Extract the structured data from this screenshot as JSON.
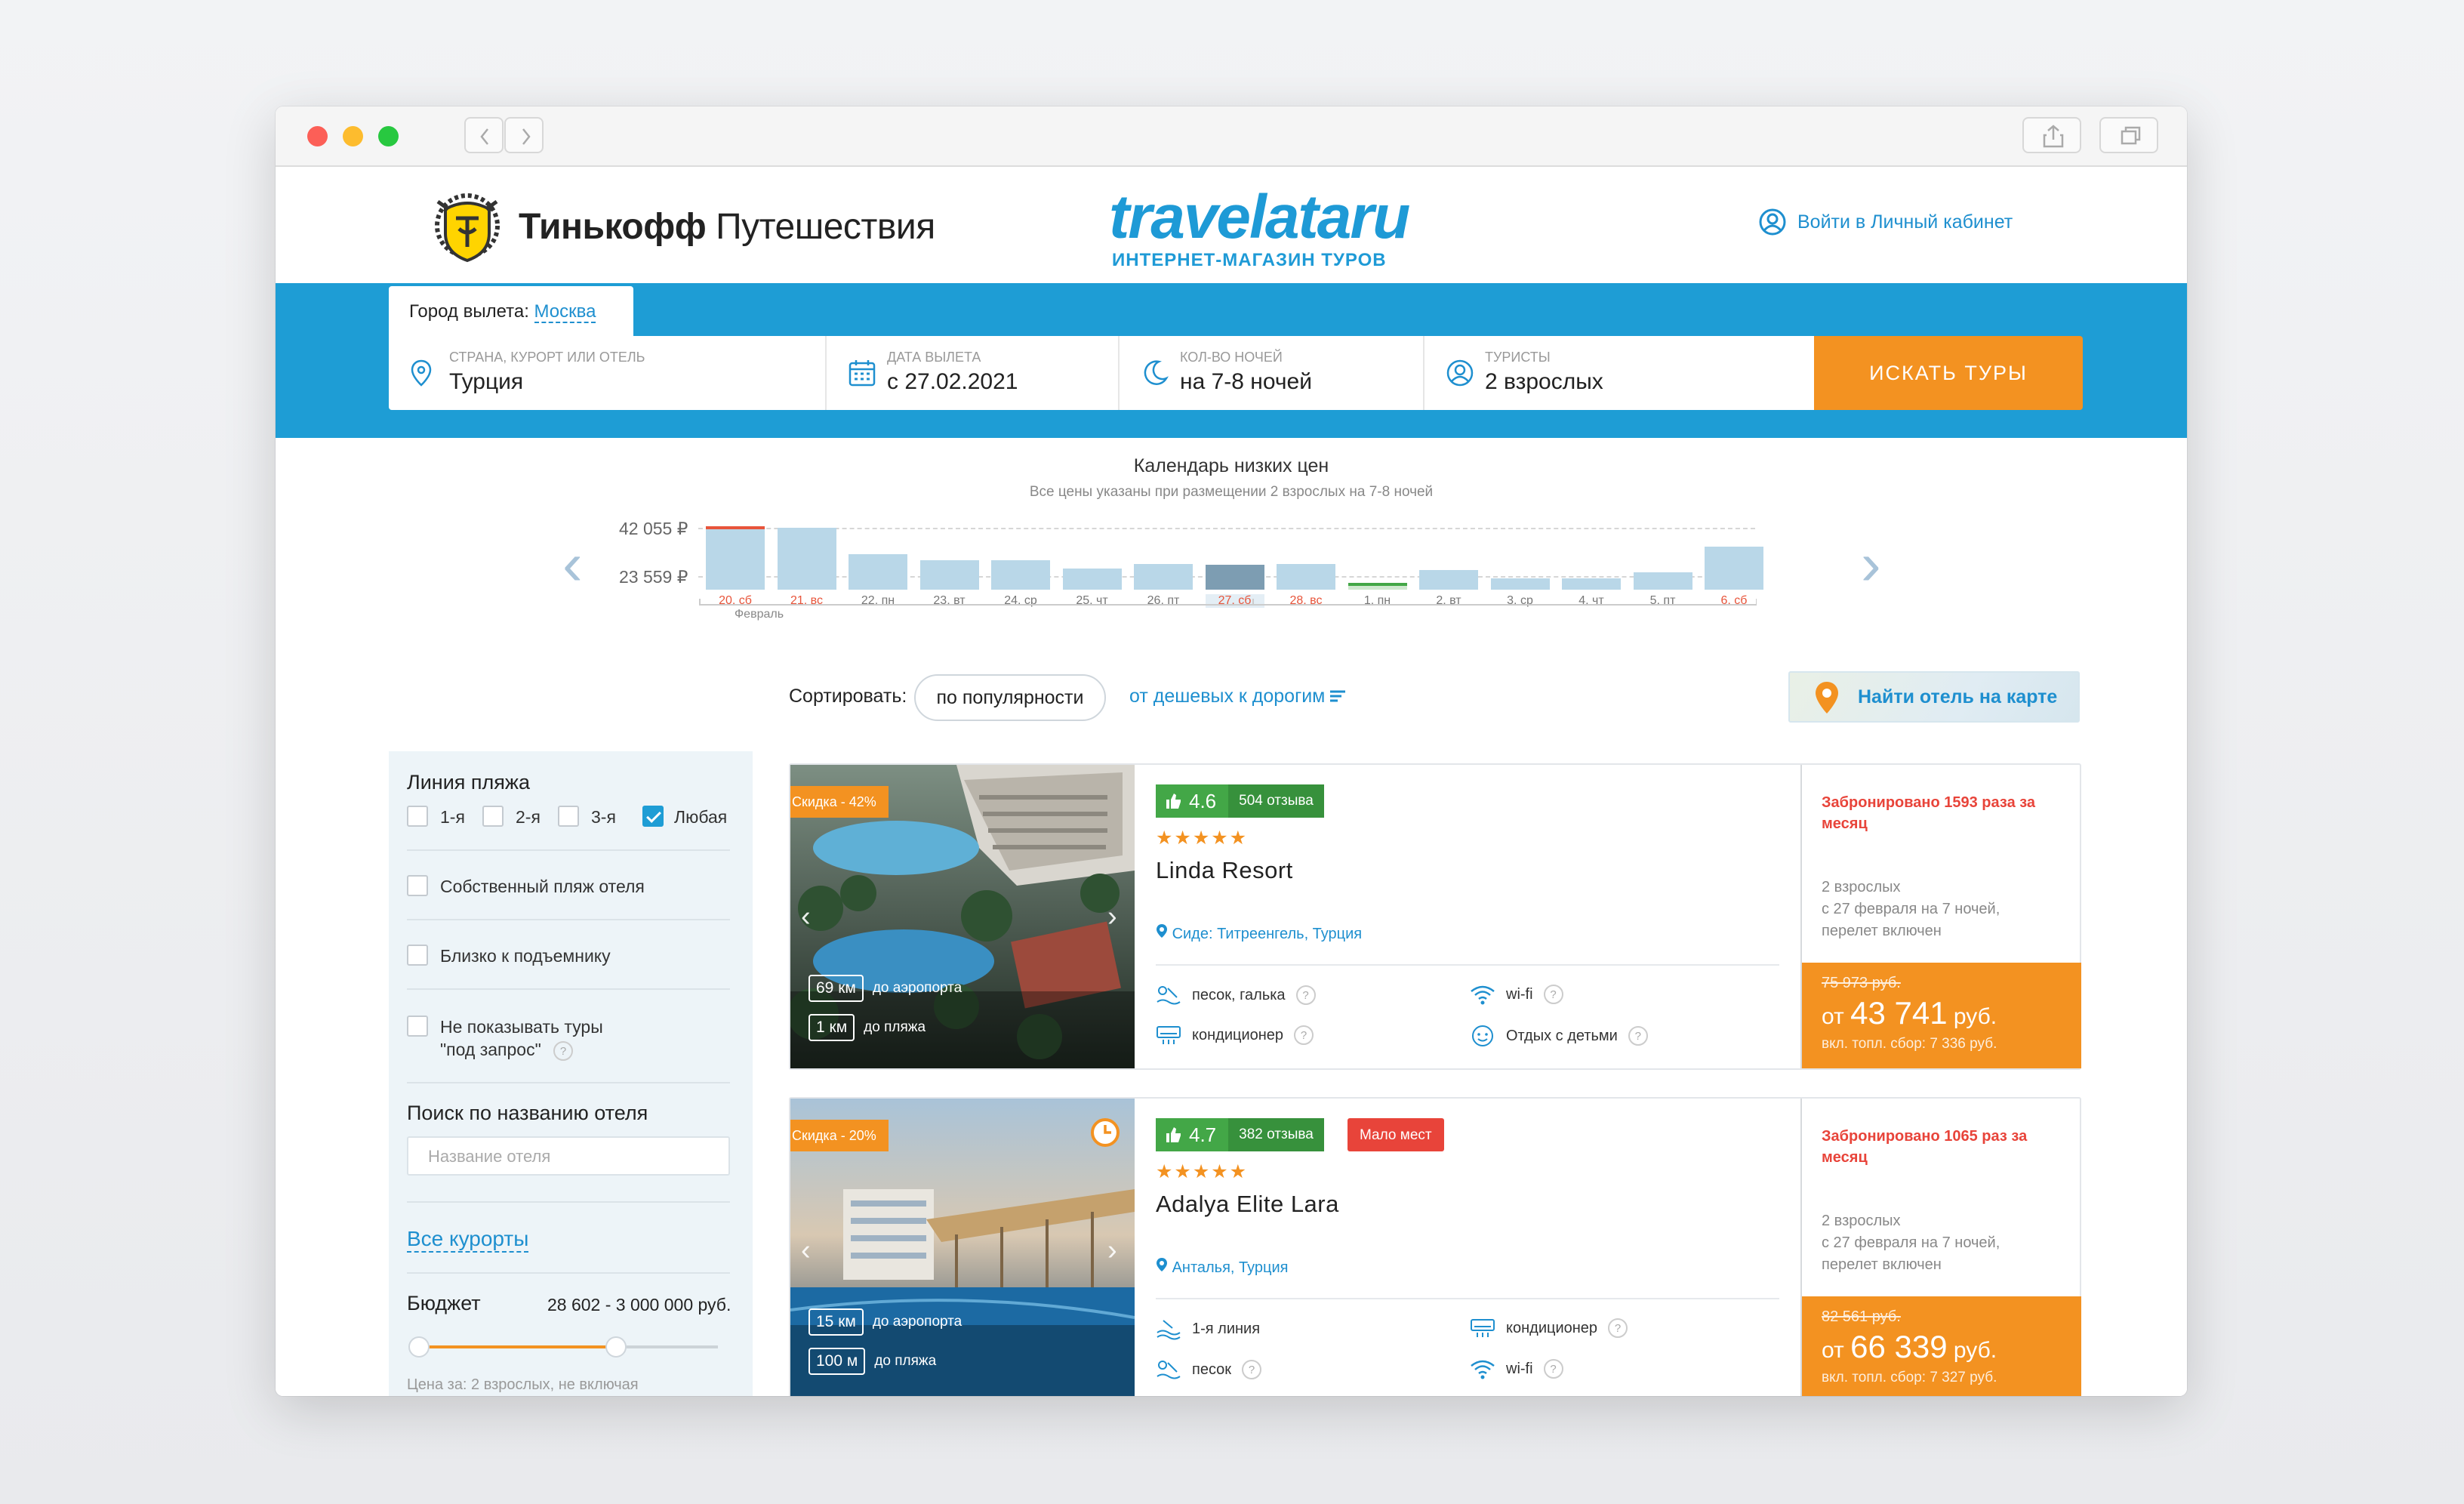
{
  "brand": {
    "name_bold": "Тинькофф",
    "name_rest": "Путешествия"
  },
  "partner": {
    "logo": "travelataru",
    "tagline": "ИНТЕРНЕТ-МАГАЗИН ТУРОВ"
  },
  "login": {
    "label": "Войти в Личный кабинет",
    "icon": "user-circle-icon"
  },
  "search": {
    "city_label": "Город вылета:",
    "city_value": "Москва",
    "fields": [
      {
        "label": "СТРАНА, КУРОРТ ИЛИ ОТЕЛЬ",
        "value": "Турция",
        "icon": "pin-icon"
      },
      {
        "label": "ДАТА ВЫЛЕТА",
        "value": "с 27.02.2021",
        "icon": "calendar-icon"
      },
      {
        "label": "КОЛ-ВО НОЧЕЙ",
        "value": "на 7-8 ночей",
        "icon": "moon-icon"
      },
      {
        "label": "ТУРИСТЫ",
        "value": "2 взрослых",
        "icon": "user-icon"
      }
    ],
    "button": "ИСКАТЬ ТУРЫ"
  },
  "calendar": {
    "title": "Календарь низких цен",
    "subtitle": "Все цены указаны при размещении 2 взрослых на 7-8 ночей",
    "max_price": "42 055 ₽",
    "min_price": "23 559 ₽",
    "month": "Февраль",
    "days": [
      {
        "label": "20, сб",
        "level": 0.98,
        "weekend": true,
        "state": "max"
      },
      {
        "label": "21, вс",
        "level": 0.95,
        "weekend": true,
        "state": ""
      },
      {
        "label": "22, пн",
        "level": 0.55,
        "weekend": false,
        "state": ""
      },
      {
        "label": "23, вт",
        "level": 0.45,
        "weekend": false,
        "state": ""
      },
      {
        "label": "24, ср",
        "level": 0.45,
        "weekend": false,
        "state": ""
      },
      {
        "label": "25, чт",
        "level": 0.33,
        "weekend": false,
        "state": ""
      },
      {
        "label": "26, пт",
        "level": 0.4,
        "weekend": false,
        "state": ""
      },
      {
        "label": "27, сб",
        "level": 0.38,
        "weekend": true,
        "state": "selected"
      },
      {
        "label": "28, вс",
        "level": 0.4,
        "weekend": true,
        "state": ""
      },
      {
        "label": "1, пн",
        "level": 0.1,
        "weekend": false,
        "state": "min"
      },
      {
        "label": "2, вт",
        "level": 0.3,
        "weekend": false,
        "state": ""
      },
      {
        "label": "3, ср",
        "level": 0.18,
        "weekend": false,
        "state": ""
      },
      {
        "label": "4, чт",
        "level": 0.18,
        "weekend": false,
        "state": ""
      },
      {
        "label": "5, пт",
        "level": 0.27,
        "weekend": false,
        "state": ""
      },
      {
        "label": "6, сб",
        "level": 0.66,
        "weekend": true,
        "state": ""
      }
    ]
  },
  "sort": {
    "label": "Сортировать:",
    "active": "по популярности",
    "alt": "от дешевых к дорогим"
  },
  "map_button": "Найти отель на карте",
  "filters": {
    "beach_title": "Линия пляжа",
    "beach_options": [
      {
        "label": "1-я",
        "checked": false
      },
      {
        "label": "2-я",
        "checked": false
      },
      {
        "label": "3-я",
        "checked": false
      },
      {
        "label": "Любая",
        "checked": true
      }
    ],
    "own_beach": "Собственный пляж отеля",
    "lift": "Близко к подъемнику",
    "no_request_1": "Не показывать туры",
    "no_request_2": "\"под запрос\"",
    "hotel_search_title": "Поиск по названию отеля",
    "hotel_search_placeholder": "Название отеля",
    "all_resorts": "Все курорты",
    "budget_title": "Бюджет",
    "budget_value": "28 602 - 3 000 000 руб.",
    "budget_fraction": 0.66,
    "budget_note": "Цена за: 2 взрослых, не включая"
  },
  "hotels": [
    {
      "discount": "Скидка - 42%",
      "rating": "4.6",
      "reviews": "504 отзыва",
      "stars": "★★★★★",
      "name": "Linda Resort",
      "location": "Сиде: Титреенгель, Турция",
      "airport_km": "69 км",
      "airport_label": "до аэропорта",
      "beach_km": "1 км",
      "beach_label": "до пляжа",
      "amenities": [
        "песок, галька",
        "wi-fi",
        "кондиционер",
        "Отдых с детьми"
      ],
      "booked": "Забронировано 1593 раза за месяц",
      "tourists": "2 взрослых",
      "dates": "с 27 февраля на 7 ночей,",
      "flight": "перелет включен",
      "old_price": "75 973 руб.",
      "price_prefix": "от",
      "price": "43 741",
      "currency": "руб.",
      "fee": "вкл. топл. сбор: 7 336 руб."
    },
    {
      "discount": "Скидка - 20%",
      "few_places": "Мало мест",
      "rating": "4.7",
      "reviews": "382 отзыва",
      "stars": "★★★★★",
      "name": "Adalya Elite Lara",
      "location": "Анталья, Турция",
      "airport_km": "15 км",
      "airport_label": "до аэропорта",
      "beach_km": "100 м",
      "beach_label": "до пляжа",
      "amenities": [
        "1-я линия",
        "кондиционер",
        "песок",
        "wi-fi"
      ],
      "booked": "Забронировано 1065 раз за месяц",
      "tourists": "2 взрослых",
      "dates": "с 27 февраля на 7 ночей,",
      "flight": "перелет включен",
      "old_price": "82 561 руб.",
      "price_prefix": "от",
      "price": "66 339",
      "currency": "руб.",
      "fee": "вкл. топл. сбор: 7 327 руб."
    }
  ],
  "colors": {
    "accent_blue": "#1e9dd5",
    "accent_orange": "#f39221",
    "rating_green": "#43a747",
    "alert_red": "#e8443a"
  }
}
